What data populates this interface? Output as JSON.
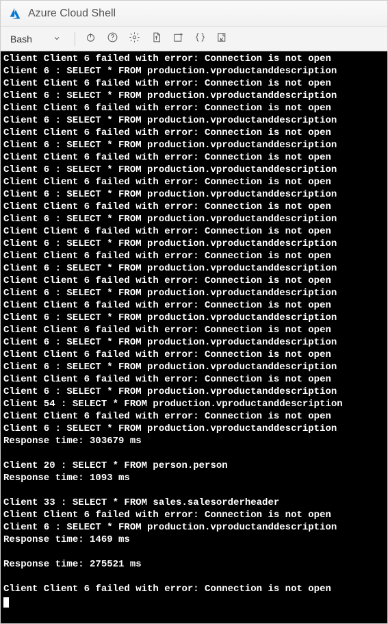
{
  "window": {
    "title": "Azure Cloud Shell"
  },
  "toolbar": {
    "shell_label": "Bash",
    "icons": {
      "power": "power-icon",
      "help": "help-icon",
      "settings": "settings-icon",
      "upload": "upload-icon",
      "newfile": "newfile-icon",
      "braces": "braces-icon",
      "editor": "editor-icon"
    }
  },
  "terminal": {
    "lines": [
      "Client Client 6 failed with error: Connection is not open",
      "Client 6 : SELECT * FROM production.vproductanddescription",
      "Client Client 6 failed with error: Connection is not open",
      "Client 6 : SELECT * FROM production.vproductanddescription",
      "Client Client 6 failed with error: Connection is not open",
      "Client 6 : SELECT * FROM production.vproductanddescription",
      "Client Client 6 failed with error: Connection is not open",
      "Client 6 : SELECT * FROM production.vproductanddescription",
      "Client Client 6 failed with error: Connection is not open",
      "Client 6 : SELECT * FROM production.vproductanddescription",
      "Client Client 6 failed with error: Connection is not open",
      "Client 6 : SELECT * FROM production.vproductanddescription",
      "Client Client 6 failed with error: Connection is not open",
      "Client 6 : SELECT * FROM production.vproductanddescription",
      "Client Client 6 failed with error: Connection is not open",
      "Client 6 : SELECT * FROM production.vproductanddescription",
      "Client Client 6 failed with error: Connection is not open",
      "Client 6 : SELECT * FROM production.vproductanddescription",
      "Client Client 6 failed with error: Connection is not open",
      "Client 6 : SELECT * FROM production.vproductanddescription",
      "Client Client 6 failed with error: Connection is not open",
      "Client 6 : SELECT * FROM production.vproductanddescription",
      "Client Client 6 failed with error: Connection is not open",
      "Client 6 : SELECT * FROM production.vproductanddescription",
      "Client Client 6 failed with error: Connection is not open",
      "Client 6 : SELECT * FROM production.vproductanddescription",
      "Client Client 6 failed with error: Connection is not open",
      "Client 6 : SELECT * FROM production.vproductanddescription",
      "Client 54 : SELECT * FROM production.vproductanddescription",
      "Client Client 6 failed with error: Connection is not open",
      "Client 6 : SELECT * FROM production.vproductanddescription",
      "Response time: 303679 ms",
      "",
      "Client 20 : SELECT * FROM person.person",
      "Response time: 1093 ms",
      "",
      "Client 33 : SELECT * FROM sales.salesorderheader",
      "Client Client 6 failed with error: Connection is not open",
      "Client 6 : SELECT * FROM production.vproductanddescription",
      "Response time: 1469 ms",
      "",
      "Response time: 275521 ms",
      "",
      "Client Client 6 failed with error: Connection is not open"
    ]
  }
}
